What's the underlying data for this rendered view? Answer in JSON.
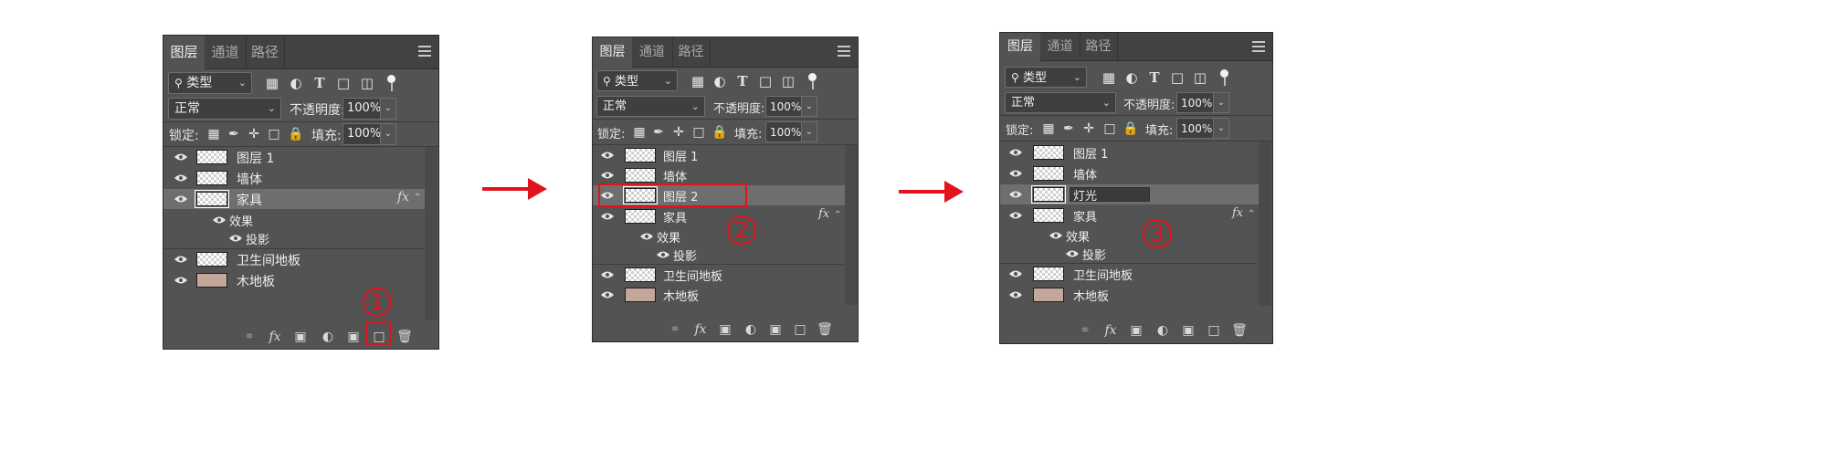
{
  "tabs": [
    "图层",
    "通道",
    "路径"
  ],
  "filter_kind": "类型",
  "blend_mode": "正常",
  "opacity_label": "不透明度:",
  "opacity_value": "100%",
  "lock_label": "锁定:",
  "fill_label": "填充:",
  "fill_value": "100%",
  "effects_label": "效果",
  "shadow_label": "投影",
  "fx_label": "fx",
  "panels": [
    {
      "layers": [
        "图层 1",
        "墙体",
        "家具",
        "卫生间地板",
        "木地板"
      ],
      "step": "1"
    },
    {
      "layers": [
        "图层 1",
        "墙体",
        "图层 2",
        "家具",
        "卫生间地板",
        "木地板"
      ],
      "step": "2"
    },
    {
      "layers": [
        "图层 1",
        "墙体",
        "灯光",
        "家具",
        "卫生间地板",
        "木地板"
      ],
      "step": "3"
    }
  ],
  "colors": {
    "panel_bg": "#535353",
    "tab_bar": "#424242",
    "selected_row": "#6e6e6e",
    "annotation_red": "#e0141b"
  }
}
